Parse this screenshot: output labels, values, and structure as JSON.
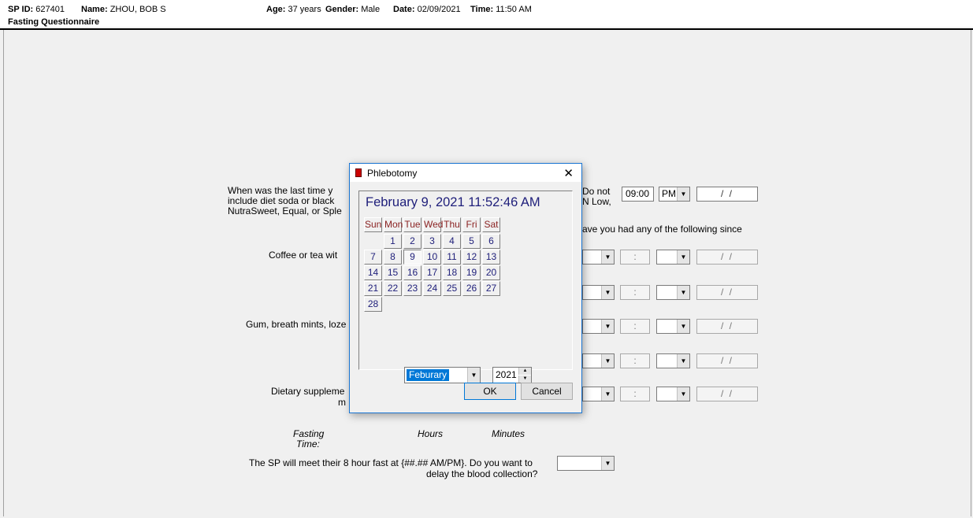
{
  "header": {
    "sp_id_label": "SP ID:",
    "sp_id": "627401",
    "name_label": "Name:",
    "name": "ZHOU, BOB S",
    "age_label": "Age:",
    "age": "37 years",
    "gender_label": "Gender:",
    "gender": "Male",
    "date_label": "Date:",
    "date": "02/09/2021",
    "time_label": "Time:",
    "time": "11:50 AM",
    "form_title": "Fasting Questionnaire"
  },
  "form": {
    "q1_line1": "When was the last time y",
    "q1_line2": "include diet soda or black",
    "q1_line3": "NutraSweet, Equal, or Sple",
    "q1_right_line1": "Do not",
    "q1_right_line2": "N Low,",
    "q1_time": "09:00",
    "q1_ampm": "PM",
    "q1_date": "/ /",
    "since_text": "ave you had any of the following since",
    "coffee_label": "Coffee or tea wit",
    "gum_label": "Gum, breath mints, loze",
    "dietary_line1": "Dietary suppleme",
    "dietary_line2": "m",
    "time_colon": ":",
    "date_blank": "/ /",
    "fasting_time_label_1": "Fasting",
    "fasting_time_label_2": "Time:",
    "hours_label": "Hours",
    "minutes_label": "Minutes",
    "meet_text_line1": "The SP will meet their 8 hour fast at {##.## AM/PM}. Do you want to",
    "meet_text_line2": "delay the blood collection?",
    "delay_value": ""
  },
  "dialog": {
    "title": "Phlebotomy",
    "close_glyph": "✕",
    "datetime": "February 9, 2021  11:52:46 AM",
    "weekdays": [
      "Sun",
      "Mon",
      "Tue",
      "Wed",
      "Thu",
      "Fri",
      "Sat"
    ],
    "days": [
      "1",
      "2",
      "3",
      "4",
      "5",
      "6",
      "7",
      "8",
      "9",
      "10",
      "11",
      "12",
      "13",
      "14",
      "15",
      "16",
      "17",
      "18",
      "19",
      "20",
      "21",
      "22",
      "23",
      "24",
      "25",
      "26",
      "27",
      "28"
    ],
    "selected_day": "9",
    "month": "Feburary",
    "year": "2021",
    "ok_label": "OK",
    "cancel_label": "Cancel"
  },
  "icons": {
    "dropdown": "chevron-down-icon",
    "spinner": "spinner-arrows-icon",
    "close": "close-icon",
    "app": "phlebotomy-app-icon"
  }
}
